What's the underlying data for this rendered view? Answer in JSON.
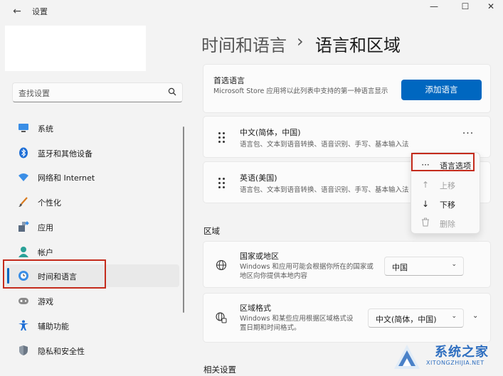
{
  "window": {
    "title": "设置",
    "back_glyph": "←",
    "minimize_glyph": "—",
    "maximize_glyph": "☐",
    "close_glyph": "✕"
  },
  "sidebar": {
    "search_placeholder": "查找设置",
    "items": [
      {
        "label": "系统",
        "icon": "monitor-icon"
      },
      {
        "label": "蓝牙和其他设备",
        "icon": "bluetooth-icon"
      },
      {
        "label": "网络和 Internet",
        "icon": "wifi-icon"
      },
      {
        "label": "个性化",
        "icon": "brush-icon"
      },
      {
        "label": "应用",
        "icon": "apps-icon"
      },
      {
        "label": "帐户",
        "icon": "account-icon"
      },
      {
        "label": "时间和语言",
        "icon": "time-language-icon",
        "active": true
      },
      {
        "label": "游戏",
        "icon": "gamepad-icon"
      },
      {
        "label": "辅助功能",
        "icon": "accessibility-icon"
      },
      {
        "label": "隐私和安全性",
        "icon": "shield-icon"
      }
    ]
  },
  "breadcrumb": {
    "parent": "时间和语言",
    "separator": "›",
    "current": "语言和区域"
  },
  "preferred_languages": {
    "title": "首选语言",
    "description": "Microsoft Store 应用将以此列表中支持的第一种语言显示",
    "add_button": "添加语言",
    "languages": [
      {
        "name": "中文(简体，中国)",
        "features": "语言包、文本到语音转换、语音识别、手写、基本输入法"
      },
      {
        "name": "英语(美国)",
        "features": "语言包、文本到语音转换、语音识别、手写、基本输入法"
      }
    ],
    "more_glyph": "···"
  },
  "context_menu": {
    "items": [
      {
        "label": "语言选项",
        "glyph": "···",
        "enabled": true
      },
      {
        "label": "上移",
        "glyph": "↑",
        "enabled": false
      },
      {
        "label": "下移",
        "glyph": "↓",
        "enabled": true
      },
      {
        "label": "删除",
        "glyph": "🗑",
        "enabled": false
      }
    ]
  },
  "region": {
    "heading": "区域",
    "country": {
      "title": "国家或地区",
      "description": "Windows 和应用可能会根据你所在的国家或地区向你提供本地内容",
      "value": "中国"
    },
    "format": {
      "title": "区域格式",
      "description": "Windows 和某些应用根据区域格式设置日期和时间格式。",
      "value": "中文(简体，中国)"
    }
  },
  "related_heading": "相关设置",
  "watermark": {
    "name": "系统之家",
    "url": "XITONGZHIJIA.NET"
  },
  "colors": {
    "accent": "#0067c0",
    "highlight_box": "#c42b1c",
    "background": "#f3f3f3",
    "card": "#fbfbfb"
  }
}
